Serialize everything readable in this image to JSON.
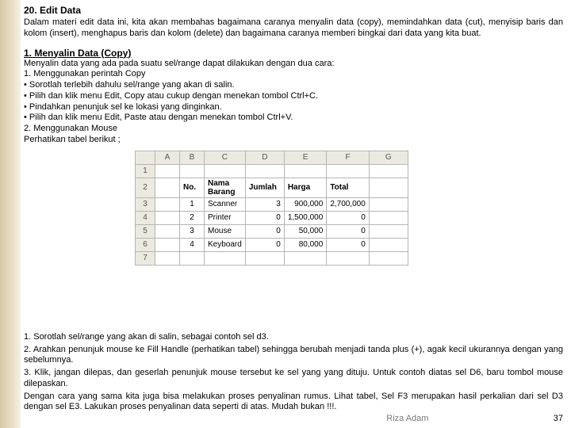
{
  "heading": "20. Edit Data",
  "intro": "Dalam materi edit data ini, kita akan membahas bagaimana caranya menyalin data (copy), memindahkan data (cut), menyisip baris dan kolom (insert), menghapus baris dan kolom (delete) dan bagaimana caranya memberi bingkai dari data yang kita buat.",
  "sub1": "1. Menyalin Data (Copy)",
  "s1_l1": "Menyalin data yang ada pada suatu sel/range dapat dilakukan dengan dua cara:",
  "s1_l2": "1. Menggunakan perintah Copy",
  "s1_l3": "• Sorotlah terlebih dahulu sel/range yang akan di salin.",
  "s1_l4": "• Pilih dan klik menu Edit, Copy atau cukup dengan menekan tombol Ctrl+C.",
  "s1_l5": "• Pindahkan penunjuk sel ke lokasi yang dinginkan.",
  "s1_l6": "• Pilih dan klik menu Edit, Paste atau dengan menekan tombol Ctrl+V.",
  "s1_l7": "2. Menggunakan Mouse",
  "s1_l8": "Perhatikan tabel berikut ;",
  "sheet": {
    "cols": [
      "A",
      "B",
      "C",
      "D",
      "E",
      "F",
      "G"
    ],
    "rows": [
      "1",
      "2",
      "3",
      "4",
      "5",
      "6",
      "7"
    ],
    "header": {
      "no": "No.",
      "nama": "Nama Barang",
      "jumlah": "Jumlah",
      "harga": "Harga",
      "total": "Total"
    },
    "data": [
      {
        "no": "1",
        "nama": "Scanner",
        "jumlah": "3",
        "harga": "900,000",
        "total": "2,700,000"
      },
      {
        "no": "2",
        "nama": "Printer",
        "jumlah": "0",
        "harga": "1,500,000",
        "total": "0"
      },
      {
        "no": "3",
        "nama": "Mouse",
        "jumlah": "0",
        "harga": "50,000",
        "total": "0"
      },
      {
        "no": "4",
        "nama": "Keyboard",
        "jumlah": "0",
        "harga": "80,000",
        "total": "0"
      }
    ]
  },
  "f_l1": "1. Sorotlah sel/range yang akan di salin, sebagai contoh sel d3.",
  "f_l2": "2. Arahkan penunjuk mouse ke Fill Handle (perhatikan tabel) sehingga berubah menjadi tanda plus (+), agak kecil ukurannya dengan yang sebelumnya.",
  "f_l3": "3. Klik, jangan dilepas, dan geserlah penunjuk mouse tersebut ke sel yang yang dituju. Untuk contoh diatas sel D6, baru tombol mouse dilepaskan.",
  "f_l4": "Dengan cara yang sama kita juga bisa melakukan proses penyalinan rumus. Lihat tabel, Sel F3 merupakan hasil perkalian dari sel D3 dengan sel E3. Lakukan proses penyalinan data seperti di atas. Mudah bukan !!!.",
  "author": "Riza Adam",
  "page": "37"
}
